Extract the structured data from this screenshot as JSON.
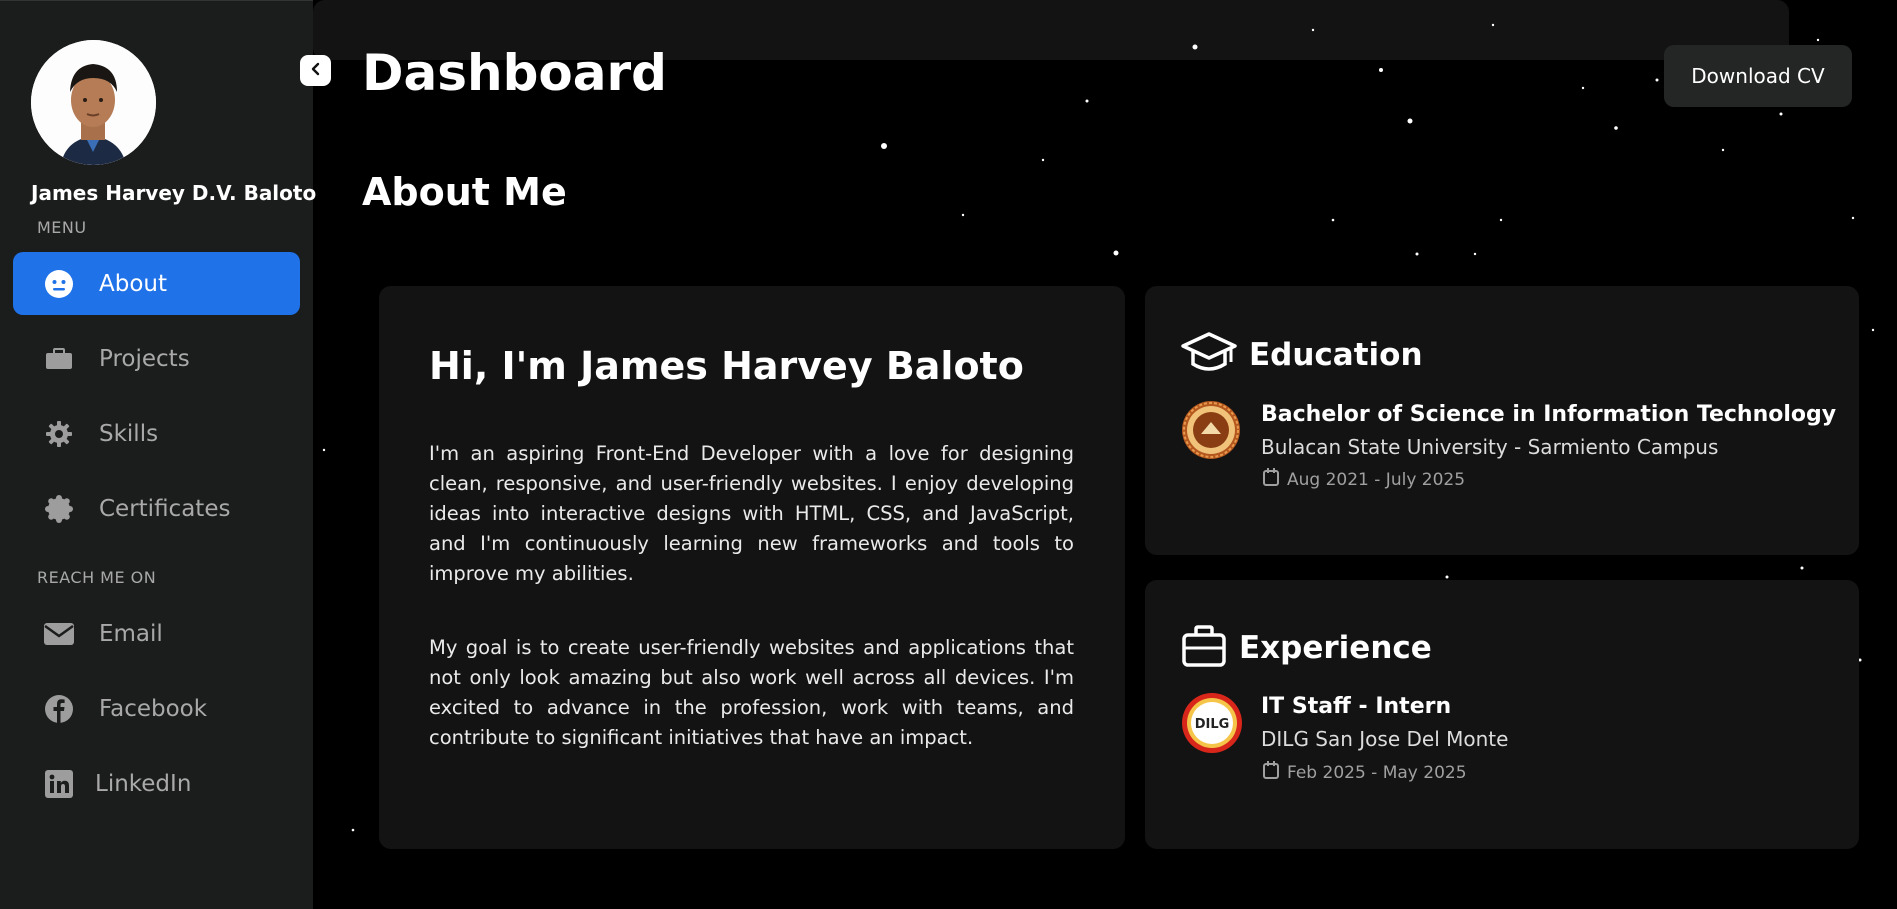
{
  "sidebar": {
    "profile_name": "James Harvey D.V. Baloto",
    "menu_label": "MENU",
    "reach_label": "REACH ME ON",
    "menu_items": [
      {
        "label": "About",
        "icon": "smile-icon",
        "active": true
      },
      {
        "label": "Projects",
        "icon": "briefcase-icon",
        "active": false
      },
      {
        "label": "Skills",
        "icon": "gear-icon",
        "active": false
      },
      {
        "label": "Certificates",
        "icon": "badge-icon",
        "active": false
      }
    ],
    "social_items": [
      {
        "label": "Email",
        "icon": "envelope-icon"
      },
      {
        "label": "Facebook",
        "icon": "facebook-icon"
      },
      {
        "label": "LinkedIn",
        "icon": "linkedin-icon"
      }
    ]
  },
  "header": {
    "title": "Dashboard",
    "download_label": "Download CV"
  },
  "about": {
    "section_title": "About Me",
    "heading": "Hi, I'm James Harvey Baloto",
    "paragraph_1": "I'm an aspiring Front-End Developer with a love for designing clean, responsive, and user-friendly websites. I enjoy developing ideas into interactive designs with HTML, CSS, and JavaScript, and I'm continuously learning new frameworks and tools to improve my abilities.",
    "paragraph_2": "My goal is to create user-friendly websites and applications that not only look amazing but also work well across all devices. I'm excited to advance in the profession, work with teams, and contribute to significant initiatives that have an impact."
  },
  "education": {
    "title": "Education",
    "degree": "Bachelor of Science in Information Technology",
    "school": "Bulacan State University - Sarmiento Campus",
    "dates": "Aug 2021 - July 2025"
  },
  "experience": {
    "title": "Experience",
    "role": "IT Staff - Intern",
    "org": "DILG San Jose Del Monte",
    "org_logo_text": "DILG",
    "dates": "Feb 2025 - May 2025"
  },
  "colors": {
    "accent": "#1f72e8",
    "sidebar_bg": "#1b1c1c",
    "card_bg": "#131313",
    "page_bg": "#000000"
  }
}
